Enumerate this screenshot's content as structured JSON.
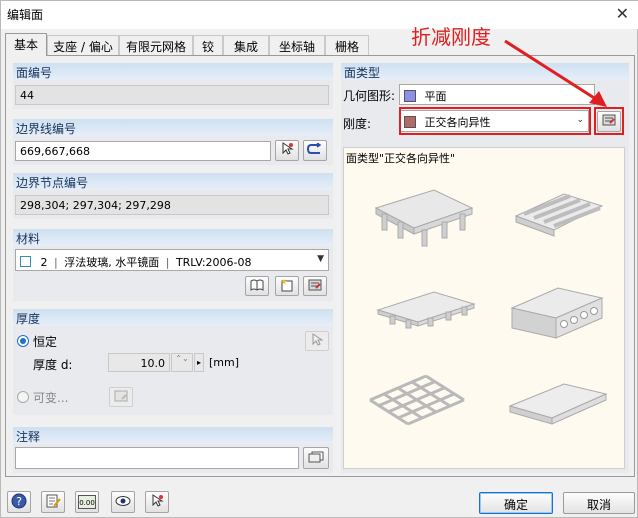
{
  "window": {
    "title": "编辑面",
    "close_glyph": "✕"
  },
  "tabs": [
    {
      "label": "基本"
    },
    {
      "label": "支座 / 偏心"
    },
    {
      "label": "有限元网格"
    },
    {
      "label": "铰"
    },
    {
      "label": "集成"
    },
    {
      "label": "坐标轴"
    },
    {
      "label": "栅格"
    }
  ],
  "surface_no": {
    "header": "面编号",
    "value": "44"
  },
  "boundary_lines": {
    "header": "边界线编号",
    "value": "669,667,668"
  },
  "boundary_nodes": {
    "header": "边界节点编号",
    "value": "298,304; 297,304; 297,298"
  },
  "material": {
    "header": "材料",
    "number": "2",
    "name": "浮法玻璃, 水平镜面",
    "standard": "TRLV:2006-08"
  },
  "thickness": {
    "header": "厚度",
    "constant_label": "恒定",
    "thickness_label": "厚度 d:",
    "value": "10.0",
    "unit": "[mm]",
    "variable_label": "可变..."
  },
  "comment": {
    "header": "注释",
    "value": ""
  },
  "surface_type": {
    "header": "面类型",
    "geometry_label": "几何图形:",
    "geometry_value": "平面",
    "geometry_color": "#8f8fe8",
    "stiffness_label": "刚度:",
    "stiffness_value": "正交各向异性",
    "stiffness_color": "#b06a6a",
    "preview_caption": "面类型\"正交各向异性\""
  },
  "annotation": {
    "text": "折减刚度",
    "color": "#e02020"
  },
  "buttons": {
    "ok": "确定",
    "cancel": "取消"
  },
  "icons": {
    "bottom": [
      "help-icon",
      "edit-icon",
      "units-icon",
      "view-icon",
      "pick-icon"
    ],
    "units_text": "0.00"
  }
}
